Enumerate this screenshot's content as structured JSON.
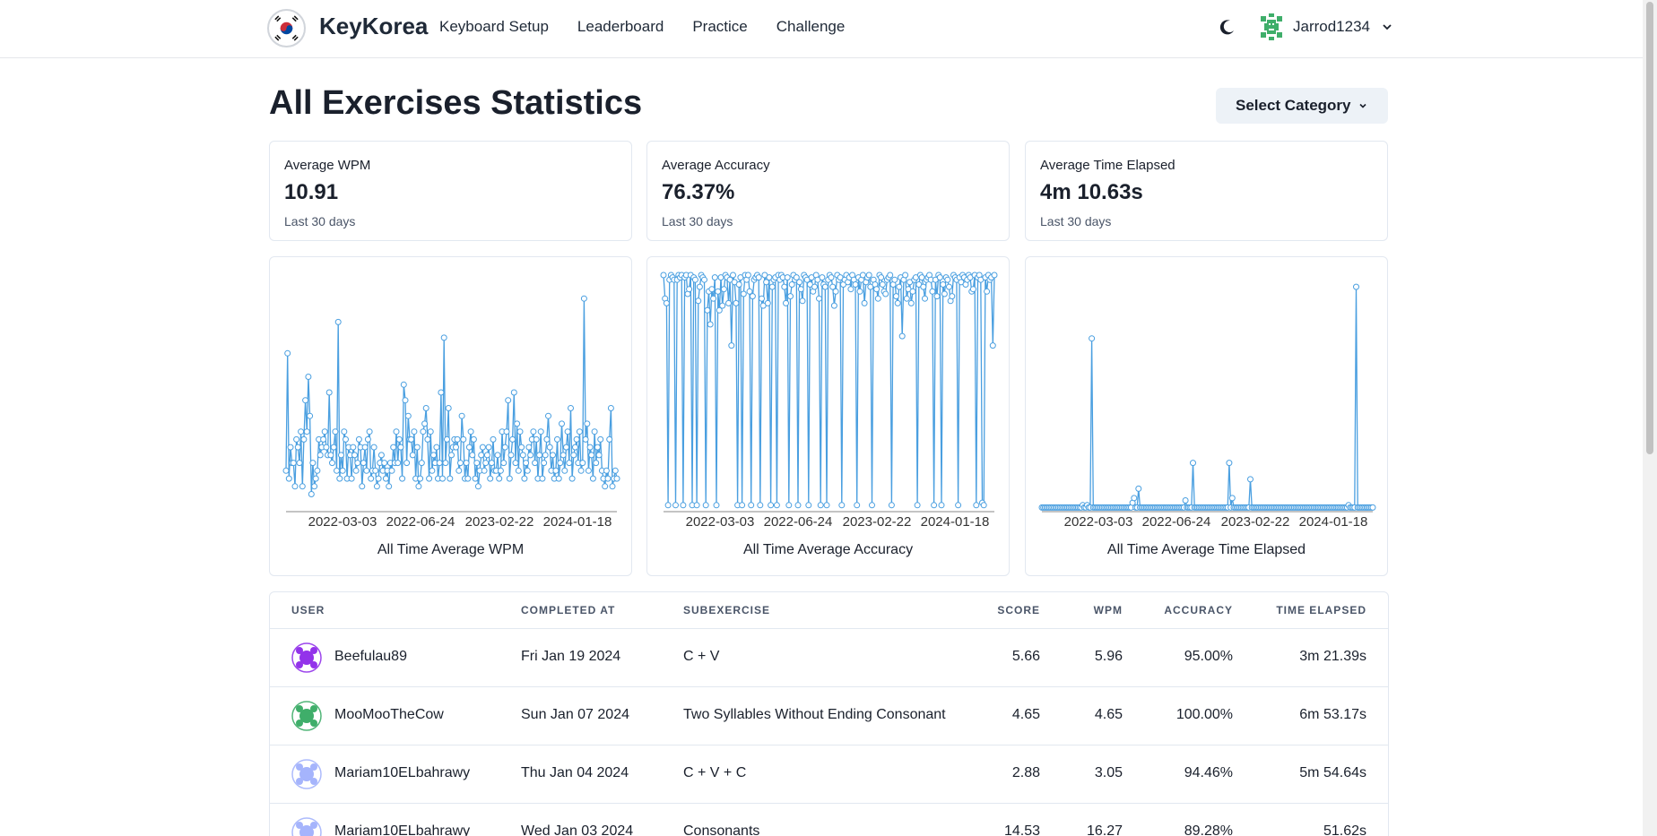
{
  "app": {
    "brand": "KeyKorea",
    "nav": [
      "Keyboard Setup",
      "Leaderboard",
      "Practice",
      "Challenge"
    ],
    "username": "Jarrod1234"
  },
  "page": {
    "title": "All Exercises Statistics",
    "select_category": "Select Category"
  },
  "stats": [
    {
      "label": "Average WPM",
      "value": "10.91",
      "period": "Last 30 days"
    },
    {
      "label": "Average Accuracy",
      "value": "76.37%",
      "period": "Last 30 days"
    },
    {
      "label": "Average Time Elapsed",
      "value": "4m 10.63s",
      "period": "Last 30 days"
    }
  ],
  "chart_data": [
    {
      "type": "line",
      "title": "All Time Average WPM",
      "x_ticks": [
        "2022-03-03",
        "2022-06-24",
        "2023-02-22",
        "2024-01-18"
      ],
      "color": "#4a9fe0",
      "values": [
        5,
        20,
        4,
        8,
        6,
        6,
        3,
        9,
        8,
        6,
        10,
        3,
        9,
        14,
        10,
        17,
        12,
        2,
        6,
        3,
        4,
        5,
        9,
        7,
        8,
        9,
        10,
        8,
        7,
        15,
        7,
        6,
        8,
        10,
        5,
        24,
        4,
        7,
        5,
        10,
        9,
        4,
        8,
        7,
        4,
        8,
        7,
        5,
        6,
        9,
        8,
        3,
        6,
        8,
        5,
        9,
        10,
        4,
        5,
        8,
        5,
        3,
        4,
        6,
        7,
        5,
        6,
        4,
        5,
        3,
        6,
        5,
        8,
        6,
        10,
        6,
        9,
        8,
        4,
        16,
        14,
        6,
        12,
        9,
        9,
        7,
        10,
        4,
        8,
        3,
        4,
        6,
        10,
        11,
        13,
        9,
        4,
        10,
        5,
        7,
        6,
        8,
        4,
        6,
        15,
        4,
        22,
        6,
        9,
        13,
        4,
        7,
        8,
        9,
        8,
        9,
        5,
        6,
        12,
        9,
        4,
        6,
        4,
        8,
        10,
        7,
        9,
        4,
        6,
        3,
        5,
        7,
        8,
        5,
        6,
        7,
        8,
        4,
        6,
        9,
        5,
        5,
        7,
        4,
        5,
        10,
        6,
        8,
        10,
        14,
        4,
        7,
        9,
        15,
        6,
        11,
        5,
        10,
        8,
        7,
        4,
        6,
        5,
        8,
        7,
        9,
        10,
        6,
        9,
        4,
        7,
        10,
        4,
        6,
        7,
        9,
        12,
        8,
        5,
        7,
        4,
        5,
        9,
        4,
        6,
        11,
        7,
        5,
        8,
        10,
        6,
        13,
        4,
        7,
        8,
        9,
        6,
        10,
        5,
        6,
        27,
        9,
        11,
        5,
        8,
        7,
        4,
        10,
        6,
        8,
        7,
        9,
        5,
        4,
        3,
        5,
        4,
        9,
        13,
        3,
        4,
        5,
        4
      ],
      "ylim": [
        0,
        30
      ]
    },
    {
      "type": "line",
      "title": "All Time Average Accuracy",
      "x_ticks": [
        "2022-03-03",
        "2022-06-24",
        "2023-02-22",
        "2024-01-18"
      ],
      "color": "#4a9fe0",
      "values": [
        100,
        90,
        88,
        2,
        98,
        100,
        99,
        98,
        2,
        98,
        100,
        99,
        100,
        2,
        99,
        100,
        92,
        94,
        100,
        2,
        99,
        98,
        2,
        89,
        95,
        100,
        99,
        98,
        2,
        85,
        93,
        79,
        94,
        90,
        99,
        2,
        93,
        85,
        99,
        87,
        94,
        100,
        99,
        88,
        98,
        70,
        100,
        97,
        88,
        2,
        96,
        99,
        2,
        92,
        100,
        98,
        100,
        93,
        2,
        91,
        98,
        99,
        100,
        99,
        2,
        90,
        87,
        100,
        97,
        88,
        99,
        2,
        95,
        98,
        99,
        2,
        100,
        98,
        100,
        99,
        95,
        88,
        99,
        2,
        91,
        96,
        100,
        98,
        99,
        2,
        97,
        94,
        89,
        100,
        99,
        98,
        2,
        96,
        99,
        93,
        95,
        100,
        98,
        90,
        2,
        99,
        96,
        95,
        2,
        98,
        100,
        99,
        95,
        87,
        93,
        100,
        98,
        99,
        2,
        96,
        98,
        100,
        97,
        99,
        94,
        100,
        98,
        96,
        2,
        99,
        93,
        98,
        100,
        88,
        97,
        99,
        100,
        95,
        2,
        98,
        96,
        94,
        90,
        100,
        99,
        96,
        93,
        92,
        98,
        99,
        100,
        2,
        96,
        98,
        91,
        88,
        95,
        99,
        74,
        98,
        100,
        90,
        94,
        97,
        88,
        93,
        98,
        99,
        2,
        96,
        100,
        99,
        95,
        90,
        98,
        99,
        100,
        98,
        93,
        2,
        98,
        91,
        100,
        99,
        2,
        96,
        92,
        99,
        98,
        95,
        89,
        91,
        100,
        99,
        98,
        2,
        99,
        97,
        100,
        99,
        96,
        98,
        100,
        99,
        93,
        94,
        100,
        2,
        99,
        100,
        98,
        3,
        2,
        99,
        93,
        100,
        98,
        99,
        70,
        100
      ],
      "ylim": [
        0,
        100
      ]
    },
    {
      "type": "line",
      "title": "All Time Average Time Elapsed",
      "x_ticks": [
        "2022-03-03",
        "2022-06-24",
        "2023-02-22",
        "2024-01-18"
      ],
      "color": "#4a9fe0",
      "values": [
        1,
        1,
        1,
        1,
        1,
        1,
        1,
        1,
        1,
        1,
        1,
        1,
        1,
        1,
        1,
        1,
        1,
        1,
        1,
        1,
        1,
        1,
        1,
        1,
        1,
        1,
        1,
        1,
        1,
        1,
        2,
        1,
        1,
        1,
        1,
        1,
        1,
        1,
        1,
        1,
        1,
        1,
        1,
        1,
        1,
        1,
        1,
        1,
        1,
        1,
        1,
        1,
        1,
        1,
        1,
        1,
        1,
        1,
        1,
        1,
        3,
        1,
        1,
        1,
        1,
        1,
        1,
        1,
        1,
        1,
        1,
        1,
        1,
        1,
        1,
        1,
        1,
        1,
        1,
        1,
        1,
        1,
        1,
        1,
        1,
        1,
        1,
        1,
        1,
        1,
        1,
        1,
        1,
        1,
        1,
        1,
        1,
        1,
        1,
        1,
        2,
        1,
        1,
        1,
        1,
        1,
        1,
        1,
        1,
        1,
        1,
        1,
        1,
        1,
        1,
        1,
        1,
        1,
        1,
        1,
        1,
        1,
        1,
        1,
        1,
        1,
        1,
        1,
        1,
        1,
        1,
        1,
        1,
        1,
        1,
        1,
        1,
        1,
        1,
        1,
        1,
        1,
        1,
        1,
        1,
        1,
        1,
        1,
        1,
        1,
        1,
        1,
        1,
        1,
        1,
        1,
        1,
        1,
        1,
        1,
        1,
        1,
        1,
        1,
        1,
        1,
        1,
        1,
        1,
        1,
        1,
        1,
        1,
        1,
        1,
        1,
        1,
        1,
        1,
        1,
        1,
        1,
        1,
        1,
        1,
        1,
        1,
        1,
        1,
        1,
        1,
        1,
        1,
        1,
        1,
        1,
        1,
        1,
        1,
        1,
        1,
        1,
        1,
        1,
        1,
        1,
        1,
        1,
        1,
        1,
        1,
        1,
        1,
        1,
        1,
        1,
        1,
        1,
        1,
        1
      ],
      "spikes": [
        [
          8,
          1
        ],
        [
          20,
          1
        ],
        [
          27,
          2
        ],
        [
          33,
          73
        ],
        [
          42,
          1
        ],
        [
          52,
          1
        ],
        [
          61,
          5
        ],
        [
          64,
          9
        ],
        [
          74,
          1
        ],
        [
          76,
          1
        ],
        [
          86,
          1
        ],
        [
          95,
          4
        ],
        [
          100,
          20
        ],
        [
          107,
          1
        ],
        [
          116,
          1
        ],
        [
          120,
          1
        ],
        [
          124,
          20
        ],
        [
          126,
          5
        ],
        [
          138,
          13
        ],
        [
          150,
          1
        ],
        [
          160,
          1
        ],
        [
          173,
          1
        ],
        [
          180,
          1
        ],
        [
          188,
          1
        ],
        [
          196,
          1
        ],
        [
          203,
          2
        ],
        [
          208,
          95
        ],
        [
          213,
          1
        ],
        [
          216,
          1
        ]
      ],
      "ylim": [
        0,
        100
      ]
    }
  ],
  "table": {
    "headers": [
      "USER",
      "COMPLETED AT",
      "SUBEXERCISE",
      "SCORE",
      "WPM",
      "ACCURACY",
      "TIME ELAPSED"
    ],
    "rows": [
      {
        "user": "Beefulau89",
        "date": "Fri Jan 19 2024",
        "sub": "C + V",
        "score": "5.66",
        "wpm": "5.96",
        "acc": "95.00%",
        "time": "3m 21.39s",
        "avatar_color": "#9333ea"
      },
      {
        "user": "MooMooTheCow",
        "date": "Sun Jan 07 2024",
        "sub": "Two Syllables Without Ending Consonant",
        "score": "4.65",
        "wpm": "4.65",
        "acc": "100.00%",
        "time": "6m 53.17s",
        "avatar_color": "#3fae6a"
      },
      {
        "user": "Mariam10ELbahrawy",
        "date": "Thu Jan 04 2024",
        "sub": "C + V + C",
        "score": "2.88",
        "wpm": "3.05",
        "acc": "94.46%",
        "time": "5m 54.64s",
        "avatar_color": "#a5b4fc"
      },
      {
        "user": "Mariam10ELbahrawy",
        "date": "Wed Jan 03 2024",
        "sub": "Consonants",
        "score": "14.53",
        "wpm": "16.27",
        "acc": "89.28%",
        "time": "51.62s",
        "avatar_color": "#a5b4fc"
      }
    ]
  }
}
